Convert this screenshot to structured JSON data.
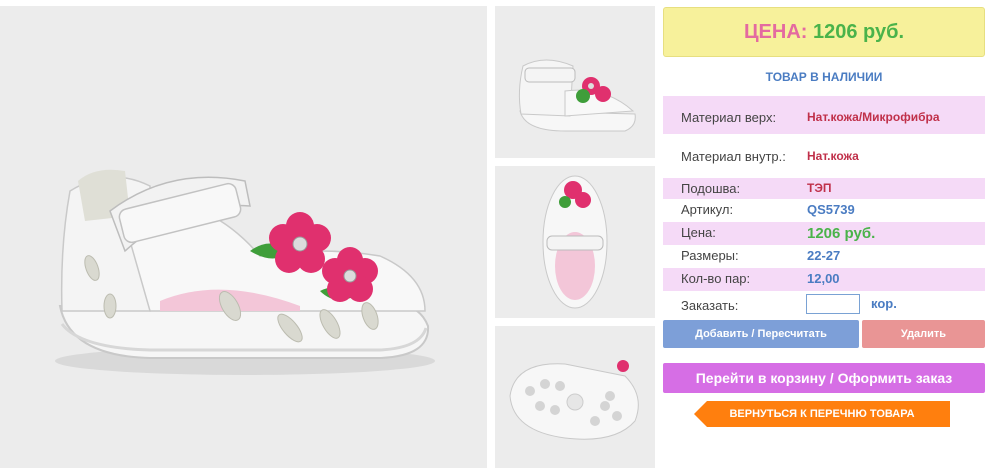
{
  "product": {
    "price_label": "ЦЕНА:",
    "price_value": "1206 руб.",
    "stock_status": "ТОВАР В НАЛИЧИИ"
  },
  "specs": [
    {
      "label": "Материал верх:",
      "value": "Нат.кожа/Микрофибра"
    },
    {
      "label": "Материал внутр.:",
      "value": "Нат.кожа"
    },
    {
      "label": "Подошва:",
      "value": "ТЭП"
    },
    {
      "label": "Артикул:",
      "value": "QS5739"
    },
    {
      "label": "Цена:",
      "value": "1206 руб."
    },
    {
      "label": "Размеры:",
      "value": "22-27"
    },
    {
      "label": "Кол-во пар:",
      "value": "12,00"
    }
  ],
  "order": {
    "label": "Заказать:",
    "value": "",
    "unit": "кор."
  },
  "buttons": {
    "add": "Добавить / Пересчитать",
    "delete": "Удалить",
    "cart": "Перейти в корзину / Оформить заказ",
    "back": "ВЕРНУТЬСЯ К ПЕРЕЧНЮ ТОВАРА"
  },
  "colors": {
    "price_label": "#e46aa0",
    "price_value": "#4ab34a",
    "price_bg": "#f7f19b",
    "row_highlight": "#f5daf7",
    "value_red": "#c0304a",
    "value_blue": "#4a7cc2",
    "add_button": "#7d9fd8",
    "delete_button": "#e99595",
    "cart_button": "#d66ee5",
    "back_button": "#ff7f0e"
  },
  "images": {
    "main": "sandal-side-view",
    "thumbnails": [
      "sandal-angled-view",
      "sandal-top-view",
      "sandal-sole-view"
    ]
  }
}
